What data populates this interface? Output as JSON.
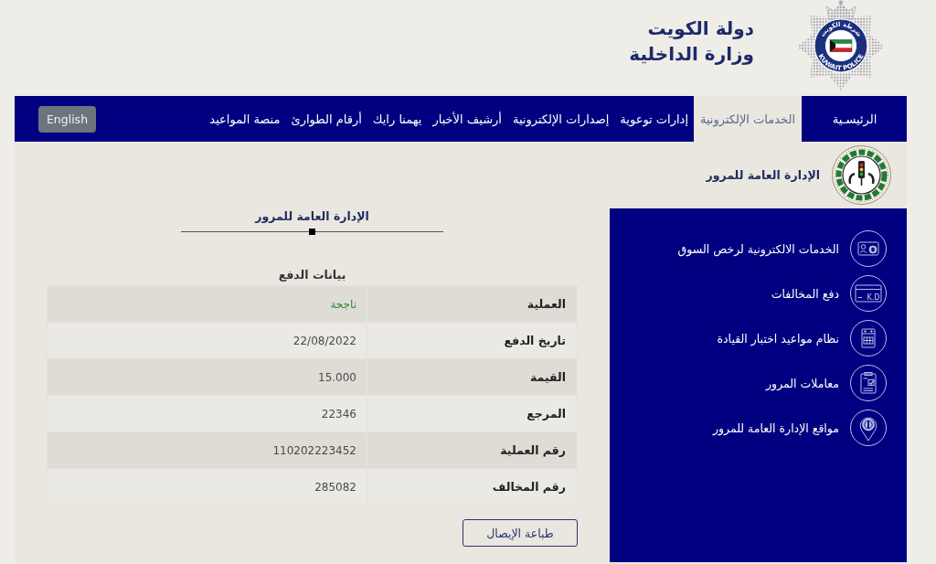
{
  "header": {
    "badge": {
      "ring_top": "شرطة الكويت",
      "ring_bottom": "KUWAIT POLICE"
    },
    "title_lines": [
      "دولة الكويت",
      "وزارة الداخلية"
    ]
  },
  "nav": {
    "items": [
      {
        "label": "الرئيسـية",
        "selected": false
      },
      {
        "label": "الخدمات الإلكترونية",
        "selected": true
      },
      {
        "label": "إدارات توعوية",
        "selected": false
      },
      {
        "label": "إصدارات الإلكترونية",
        "selected": false
      },
      {
        "label": "أرشيف الأخبار",
        "selected": false
      },
      {
        "label": "يهمنا رايك",
        "selected": false
      },
      {
        "label": "أرقام الطوارئ",
        "selected": false
      },
      {
        "label": "منصة المواعيد",
        "selected": false
      }
    ],
    "language_button": "English"
  },
  "department": {
    "name": "الإدارة العامة للمرور"
  },
  "sidebar": {
    "items": [
      {
        "label": "الخدمات الالكترونية لرخص السوق"
      },
      {
        "label": "دفع المخالفات",
        "icon_text": "K.D"
      },
      {
        "label": "نظام مواعيد اختبار القيادة"
      },
      {
        "label": "معاملات المرور"
      },
      {
        "label": "مواقع الإدارة العامة للمرور"
      }
    ]
  },
  "main": {
    "heading": "الإدارة العامة للمرور",
    "section_title": "بيانات الدفع",
    "rows": [
      {
        "label": "العملية",
        "value": "ناجحة",
        "kind": "status"
      },
      {
        "label": "تاريخ الدفع",
        "value": "22/08/2022",
        "kind": "text"
      },
      {
        "label": "القيمة",
        "value": "15.000",
        "kind": "text"
      },
      {
        "label": "المرجع",
        "value": "22346",
        "kind": "text"
      },
      {
        "label": "رقم العملية",
        "value": "110202223452",
        "kind": "text"
      },
      {
        "label": "رقم المخالف",
        "value": "285082",
        "kind": "text"
      }
    ],
    "print_button": "طباعة الإيصال"
  }
}
